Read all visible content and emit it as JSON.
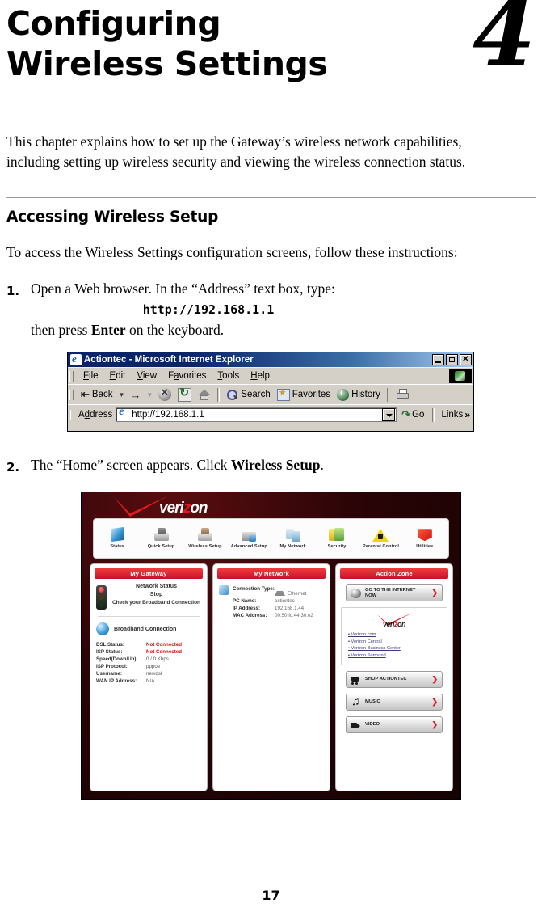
{
  "chapter": {
    "title_line1": "Configuring",
    "title_line2": "Wireless Settings",
    "number": "4",
    "intro": "This chapter explains how to set up the Gateway’s wireless network capabilities, including setting up wireless security and viewing the wireless connection status."
  },
  "section": {
    "heading": "Accessing Wireless Setup",
    "intro": "To access the Wireless Settings configuration screens, follow these instructions:"
  },
  "steps": [
    {
      "number": "1.",
      "text_before": "Open a Web browser. In the “Address” text box, type:",
      "url": "http://192.168.1.1",
      "text_after_1": "then press ",
      "text_after_bold": "Enter",
      "text_after_2": " on the keyboard."
    },
    {
      "number": "2.",
      "text_before": "The “Home” screen appears. Click ",
      "bold": "Wireless Setup",
      "text_after": "."
    }
  ],
  "browser": {
    "title": "Actiontec - Microsoft Internet Explorer",
    "title_icon": "ie-logo-icon",
    "window_buttons": [
      {
        "name": "minimize-button",
        "glyph": "_"
      },
      {
        "name": "maximize-button",
        "glyph": "□"
      },
      {
        "name": "close-button",
        "glyph": "✕"
      }
    ],
    "menu": [
      "File",
      "Edit",
      "View",
      "Favorites",
      "Tools",
      "Help"
    ],
    "toolbar": {
      "back": "Back",
      "forward": "",
      "search": "Search",
      "favorites": "Favorites",
      "history": "History",
      "stop_icon": "stop-icon",
      "refresh_icon": "refresh-icon",
      "home_icon": "home-icon",
      "print_icon": "print-icon"
    },
    "address": {
      "label": "Address",
      "value": "http://192.168.1.1",
      "go": "Go",
      "links": "Links",
      "chevrons": "»"
    }
  },
  "router": {
    "brand": {
      "prefix": "veri",
      "z": "z",
      "suffix": "on"
    },
    "nav": [
      {
        "label": "Status",
        "icon": "status-icon"
      },
      {
        "label": "Quick\nSetup",
        "icon": "quick-setup-icon"
      },
      {
        "label": "Wireless\nSetup",
        "icon": "wireless-setup-icon"
      },
      {
        "label": "Advanced\nSetup",
        "icon": "advanced-setup-icon"
      },
      {
        "label": "My Network",
        "icon": "my-network-icon"
      },
      {
        "label": "Security",
        "icon": "security-icon"
      },
      {
        "label": "Parental\nControl",
        "icon": "parental-control-icon"
      },
      {
        "label": "Utilities",
        "icon": "utilities-icon"
      }
    ],
    "my_gateway": {
      "header": "My Gateway",
      "network_status_title": "Network Status",
      "network_status_state": "Stop",
      "network_status_hint": "Check your Broadband Connection",
      "broadband_title": "Broadband Connection",
      "rows": [
        {
          "key": "DSL Status:",
          "value": "Not Connected",
          "alert": true
        },
        {
          "key": "ISP Status:",
          "value": "Not Connected",
          "alert": true
        },
        {
          "key": "Speed(Down/Up):",
          "value": "0 / 0 Kbps",
          "alert": false
        },
        {
          "key": "ISP Protocol:",
          "value": "pppoe",
          "alert": false
        },
        {
          "key": "Username:",
          "value": "newdsl",
          "alert": false
        },
        {
          "key": "WAN IP Address:",
          "value": "N/A",
          "alert": false
        }
      ]
    },
    "my_network": {
      "header": "My Network",
      "rows": [
        {
          "key": "Connection Type:",
          "value": "Ethernet"
        },
        {
          "key": "PC Name:",
          "value": "actiontec"
        },
        {
          "key": "IP Address:",
          "value": "192.168.1.44"
        },
        {
          "key": "MAC Address:",
          "value": "00:50:fc:44:30:e2"
        }
      ]
    },
    "action_zone": {
      "header": "Action Zone",
      "internet_button": "GO TO THE INTERNET NOW",
      "links": [
        "Verizon.com",
        "Verizon Central",
        "Verizon Business Center",
        "Verizon Surround"
      ],
      "buttons": [
        {
          "label": "SHOP ACTIONTEC",
          "icon": "cart-icon"
        },
        {
          "label": "MUSIC",
          "icon": "music-note-icon"
        },
        {
          "label": "VIDEO",
          "icon": "video-camera-icon"
        }
      ]
    }
  },
  "footer": {
    "page_number": "17"
  },
  "colors": {
    "verizon_red": "#e3191e",
    "panel_header_red": "#c8102e",
    "alert_red": "#d01010",
    "ie_titlebar_blue": "#0a246a",
    "ie_chrome_gray": "#d4d0c8"
  }
}
